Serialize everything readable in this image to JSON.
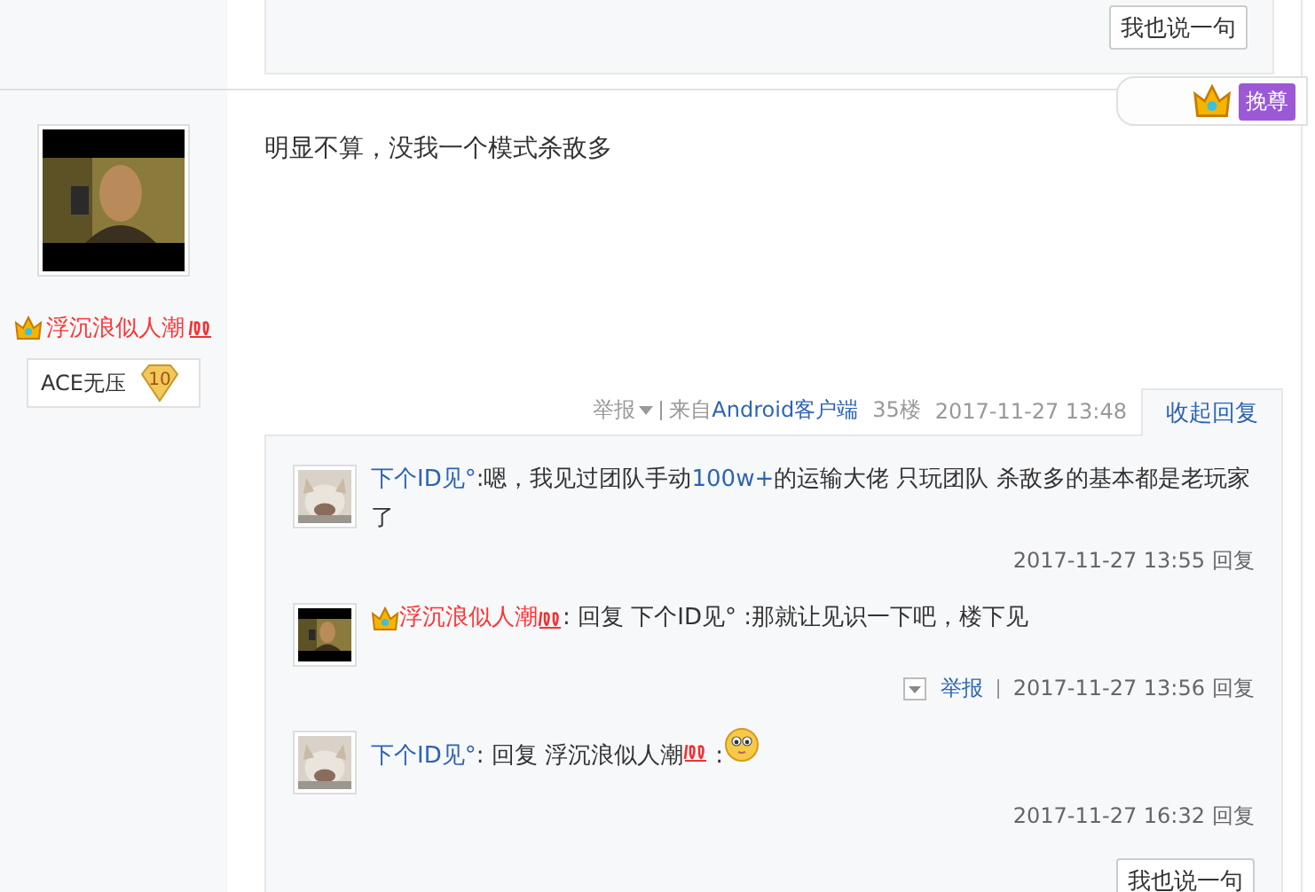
{
  "top_reply_box": {
    "button": "我也说一句"
  },
  "post_badge": {
    "label": "挽尊"
  },
  "post": {
    "author": {
      "name": "浮沉浪似人潮",
      "kind": "vip"
    },
    "honor": {
      "label": "ACE无压",
      "level": "10"
    },
    "content": "明显不算，没我一个模式杀敌多",
    "meta": {
      "report": "举报",
      "source_prefix": "来自",
      "source": "Android客户端",
      "floor": "35楼",
      "time": "2017-11-27 13:48"
    },
    "toggle": "收起回复",
    "replies": [
      {
        "author": {
          "name": "下个ID见°",
          "kind": "normal"
        },
        "parts": [
          {
            "kind": "text",
            "text": ":嗯，我见过团队手动"
          },
          {
            "kind": "link",
            "text": "100w+"
          },
          {
            "kind": "text",
            "text": "的运输大佬 只玩团队 杀敌多的基本都是老玩家了"
          }
        ],
        "time": "2017-11-27 13:55",
        "reply": "回复"
      },
      {
        "author": {
          "name": "浮沉浪似人潮",
          "kind": "vip"
        },
        "parts": [
          {
            "kind": "text",
            "text": ": 回复 下个ID见°  :那就让见识一下吧，楼下见"
          }
        ],
        "report": "举报",
        "time": "2017-11-27 13:56",
        "reply": "回复"
      },
      {
        "author": {
          "name": "下个ID见°",
          "kind": "normal"
        },
        "parts": [
          {
            "kind": "text",
            "text": ": 回复 浮沉浪似人潮"
          },
          {
            "kind": "hundred"
          },
          {
            "kind": "text",
            "text": " :"
          },
          {
            "kind": "smile"
          }
        ],
        "time": "2017-11-27 16:32",
        "reply": "回复"
      }
    ],
    "bottom_button": "我也说一句"
  }
}
